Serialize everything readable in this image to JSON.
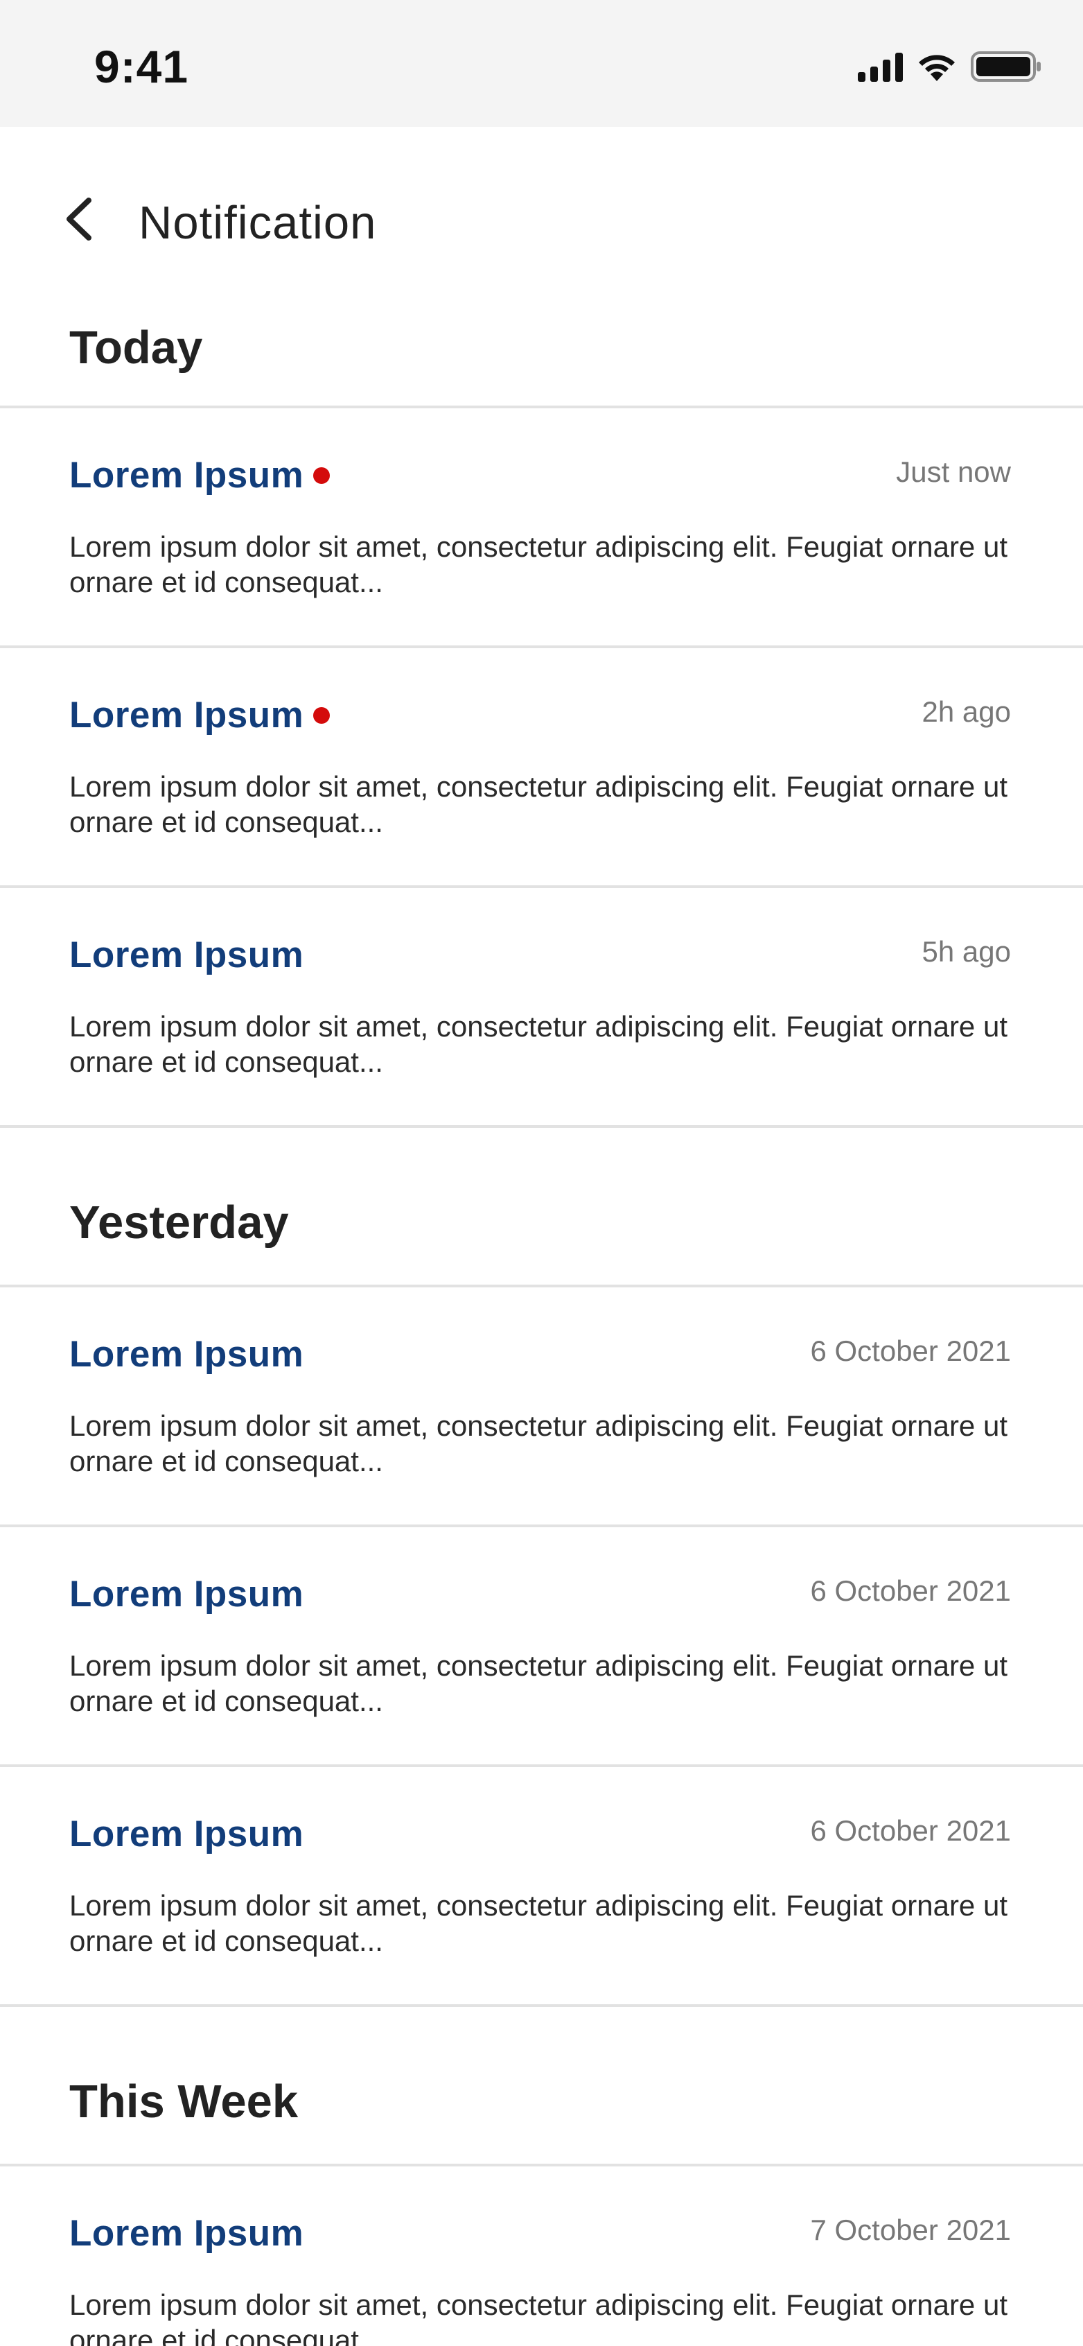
{
  "status_bar": {
    "time": "9:41",
    "icons": [
      "cellular-signal-icon",
      "wifi-icon",
      "battery-icon"
    ]
  },
  "header": {
    "back_icon": "chevron-left-icon",
    "title": "Notification"
  },
  "colors": {
    "title_accent": "#123d7a",
    "unread_dot": "#d40b0b",
    "divider": "#e2e2e2",
    "status_bar_bg": "#f4f4f4"
  },
  "sections": [
    {
      "title": "Today",
      "items": [
        {
          "title": "Lorem Ipsum",
          "unread": true,
          "time": "Just now",
          "body": "Lorem ipsum dolor sit amet, consectetur adipiscing elit. Feugiat ornare ut ornare et id consequat..."
        },
        {
          "title": "Lorem Ipsum",
          "unread": true,
          "time": "2h ago",
          "body": "Lorem ipsum dolor sit amet, consectetur adipiscing elit. Feugiat ornare ut ornare et id consequat..."
        },
        {
          "title": "Lorem Ipsum",
          "unread": false,
          "time": "5h ago",
          "body": "Lorem ipsum dolor sit amet, consectetur adipiscing elit. Feugiat ornare ut ornare et id consequat..."
        }
      ]
    },
    {
      "title": "Yesterday",
      "items": [
        {
          "title": "Lorem Ipsum",
          "unread": false,
          "time": "6 October 2021",
          "body": "Lorem ipsum dolor sit amet, consectetur adipiscing elit. Feugiat ornare ut ornare et id consequat..."
        },
        {
          "title": "Lorem Ipsum",
          "unread": false,
          "time": "6 October 2021",
          "body": "Lorem ipsum dolor sit amet, consectetur adipiscing elit. Feugiat ornare ut ornare et id consequat..."
        },
        {
          "title": "Lorem Ipsum",
          "unread": false,
          "time": "6 October 2021",
          "body": "Lorem ipsum dolor sit amet, consectetur adipiscing elit. Feugiat ornare ut ornare et id consequat..."
        }
      ]
    },
    {
      "title": "This Week",
      "items": [
        {
          "title": "Lorem Ipsum",
          "unread": false,
          "time": "7 October 2021",
          "body": "Lorem ipsum dolor sit amet, consectetur adipiscing elit. Feugiat ornare ut ornare et id consequat..."
        }
      ]
    }
  ]
}
